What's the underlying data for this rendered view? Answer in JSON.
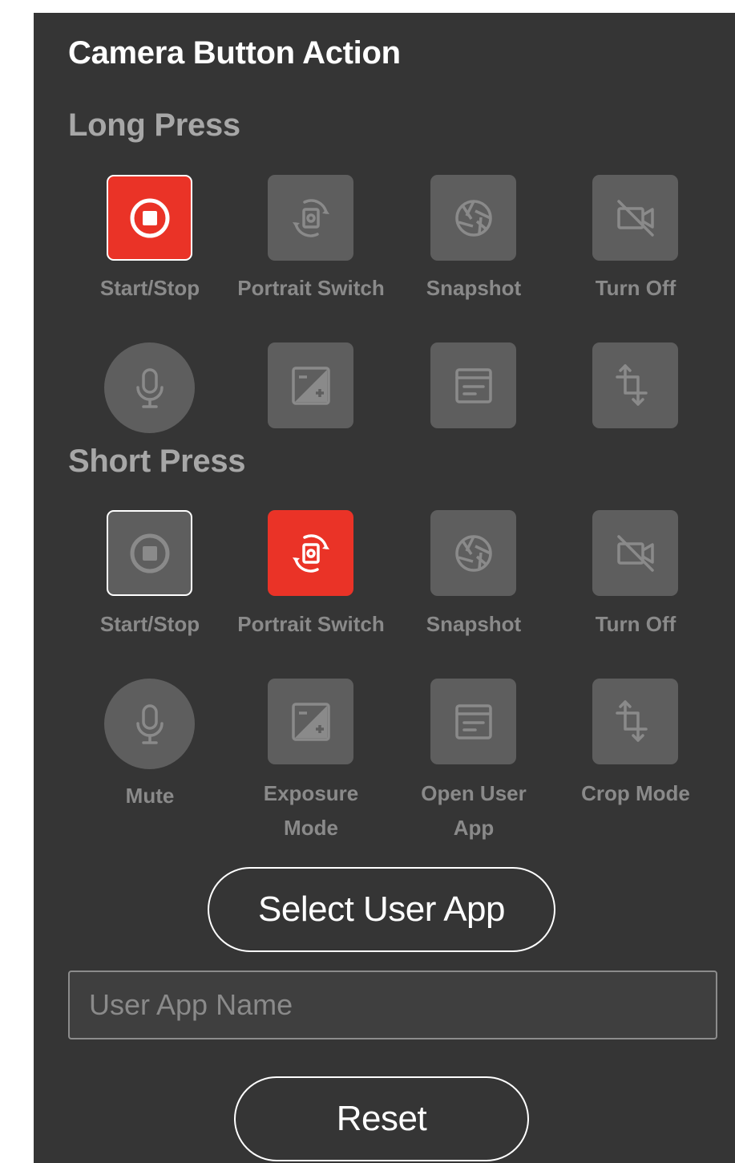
{
  "title": "Camera Button Action",
  "long_press": {
    "heading": "Long Press",
    "row1": [
      {
        "label": "Start/Stop",
        "icon": "record-stop-icon",
        "selected": true
      },
      {
        "label": "Portrait Switch",
        "icon": "rotate-camera-icon"
      },
      {
        "label": "Snapshot",
        "icon": "aperture-icon"
      },
      {
        "label": "Turn Off",
        "icon": "video-off-icon"
      }
    ],
    "row2": [
      {
        "label": "",
        "icon": "microphone-icon"
      },
      {
        "label": "",
        "icon": "exposure-icon"
      },
      {
        "label": "",
        "icon": "app-window-icon"
      },
      {
        "label": "",
        "icon": "crop-icon"
      }
    ]
  },
  "short_press": {
    "heading": "Short Press",
    "row1": [
      {
        "label": "Start/Stop",
        "icon": "record-stop-icon"
      },
      {
        "label": "Portrait Switch",
        "icon": "rotate-camera-icon",
        "selected": true
      },
      {
        "label": "Snapshot",
        "icon": "aperture-icon"
      },
      {
        "label": "Turn Off",
        "icon": "video-off-icon"
      }
    ],
    "row2": [
      {
        "label": "Mute",
        "icon": "microphone-icon"
      },
      {
        "label_line1": "Exposure",
        "label_line2": "Mode",
        "icon": "exposure-icon"
      },
      {
        "label_line1": "Open User",
        "label_line2": "App",
        "icon": "app-window-icon"
      },
      {
        "label": "Crop Mode",
        "icon": "crop-icon"
      }
    ]
  },
  "select_user_app_label": "Select User App",
  "user_app_name_placeholder": "User App Name",
  "reset_label": "Reset",
  "colors": {
    "panel": "#353535",
    "accent": "#ea3327",
    "tile": "#5e5e5e",
    "label": "#8a8a8a"
  }
}
